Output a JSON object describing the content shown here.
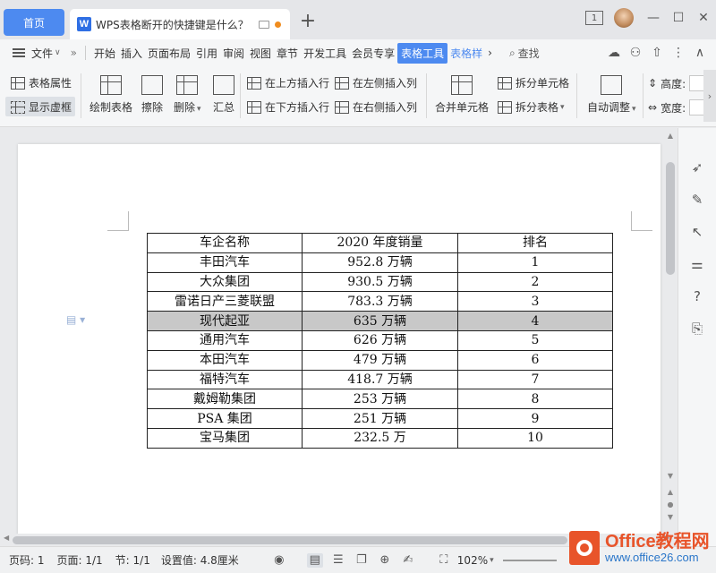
{
  "titlebar": {
    "home_tab": "首页",
    "doc_tab_title": "WPS表格断开的快捷键是什么？",
    "new_tab": "+",
    "window_badge": "1"
  },
  "menubar": {
    "file": "文件",
    "items": [
      "开始",
      "插入",
      "页面布局",
      "引用",
      "审阅",
      "视图",
      "章节",
      "开发工具",
      "会员专享"
    ],
    "active": "表格工具",
    "next": "表格样",
    "search": "查找"
  },
  "ribbon": {
    "table_props": "表格属性",
    "show_gridlines": "显示虚框",
    "draw_table": "绘制表格",
    "erase": "擦除",
    "delete": "删除",
    "summary": "汇总",
    "insert_above": "在上方插入行",
    "insert_below": "在下方插入行",
    "insert_left": "在左侧插入列",
    "insert_right": "在右侧插入列",
    "merge_cells": "合并单元格",
    "split_cells": "拆分单元格",
    "split_table": "拆分表格",
    "auto_fit": "自动调整",
    "height": "高度:",
    "width": "宽度:"
  },
  "table": {
    "headers": [
      "车企名称",
      "2020 年度销量",
      "排名"
    ],
    "rows": [
      [
        "丰田汽车",
        "952.8 万辆",
        "1"
      ],
      [
        "大众集团",
        "930.5 万辆",
        "2"
      ],
      [
        "雷诺日产三菱联盟",
        "783.3 万辆",
        "3"
      ],
      [
        "现代起亚",
        "635 万辆",
        "4"
      ],
      [
        "通用汽车",
        "626 万辆",
        "5"
      ],
      [
        "本田汽车",
        "479 万辆",
        "6"
      ],
      [
        "福特汽车",
        "418.7 万辆",
        "7"
      ],
      [
        "戴姆勒集团",
        "253 万辆",
        "8"
      ],
      [
        "PSA 集团",
        "251 万辆",
        "9"
      ],
      [
        "宝马集团",
        "232.5 万",
        "10"
      ]
    ],
    "highlighted_row": 3
  },
  "status": {
    "page_num": "页码: 1",
    "pages": "页面: 1/1",
    "section": "节: 1/1",
    "setting": "设置值: 4.8厘米",
    "zoom": "102%"
  },
  "watermark": {
    "brand": "Office教程网",
    "url": "www.office26.com"
  },
  "colors": {
    "accent": "#4d8af0",
    "highlight_row": "#c8c8c8",
    "watermark_orange": "#e8542a",
    "watermark_blue": "#2a76c9"
  }
}
